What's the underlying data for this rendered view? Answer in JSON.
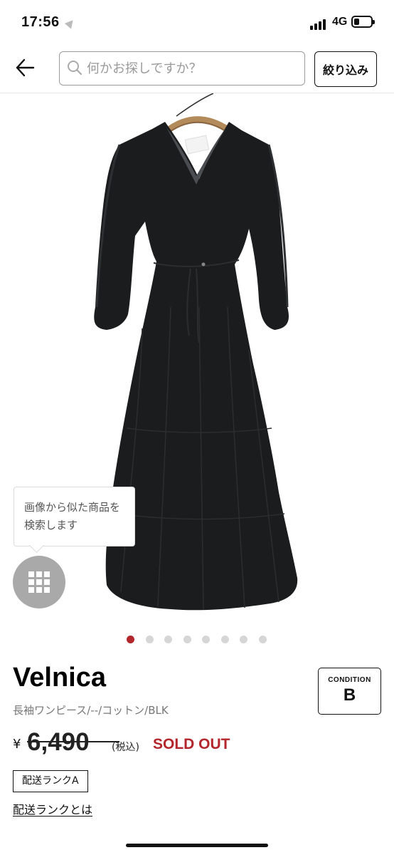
{
  "status_bar": {
    "time": "17:56",
    "network": "4G",
    "battery_level": 0.3
  },
  "nav": {
    "back_icon": "arrow-left-icon",
    "search_placeholder": "何かお探しですか？",
    "search_value": "",
    "filter_label": "絞り込み"
  },
  "image_search": {
    "tooltip": "画像から似た商品を検索します",
    "icon": "grid-icon"
  },
  "gallery": {
    "page_count": 8,
    "active_index": 0,
    "active_color": "#b3262c",
    "inactive_color": "#d6d6d6"
  },
  "product": {
    "brand": "Velnica",
    "description": "長袖ワンピース/--/コットン/BLK",
    "currency": "¥",
    "price": "6,490",
    "tax_label": "(税込)",
    "sold_out": "SOLD OUT",
    "sold_out_color": "#b3262c",
    "condition_label": "CONDITION",
    "condition_value": "B",
    "shipping_rank": "配送ランクA",
    "shipping_link": "配送ランクとは"
  }
}
